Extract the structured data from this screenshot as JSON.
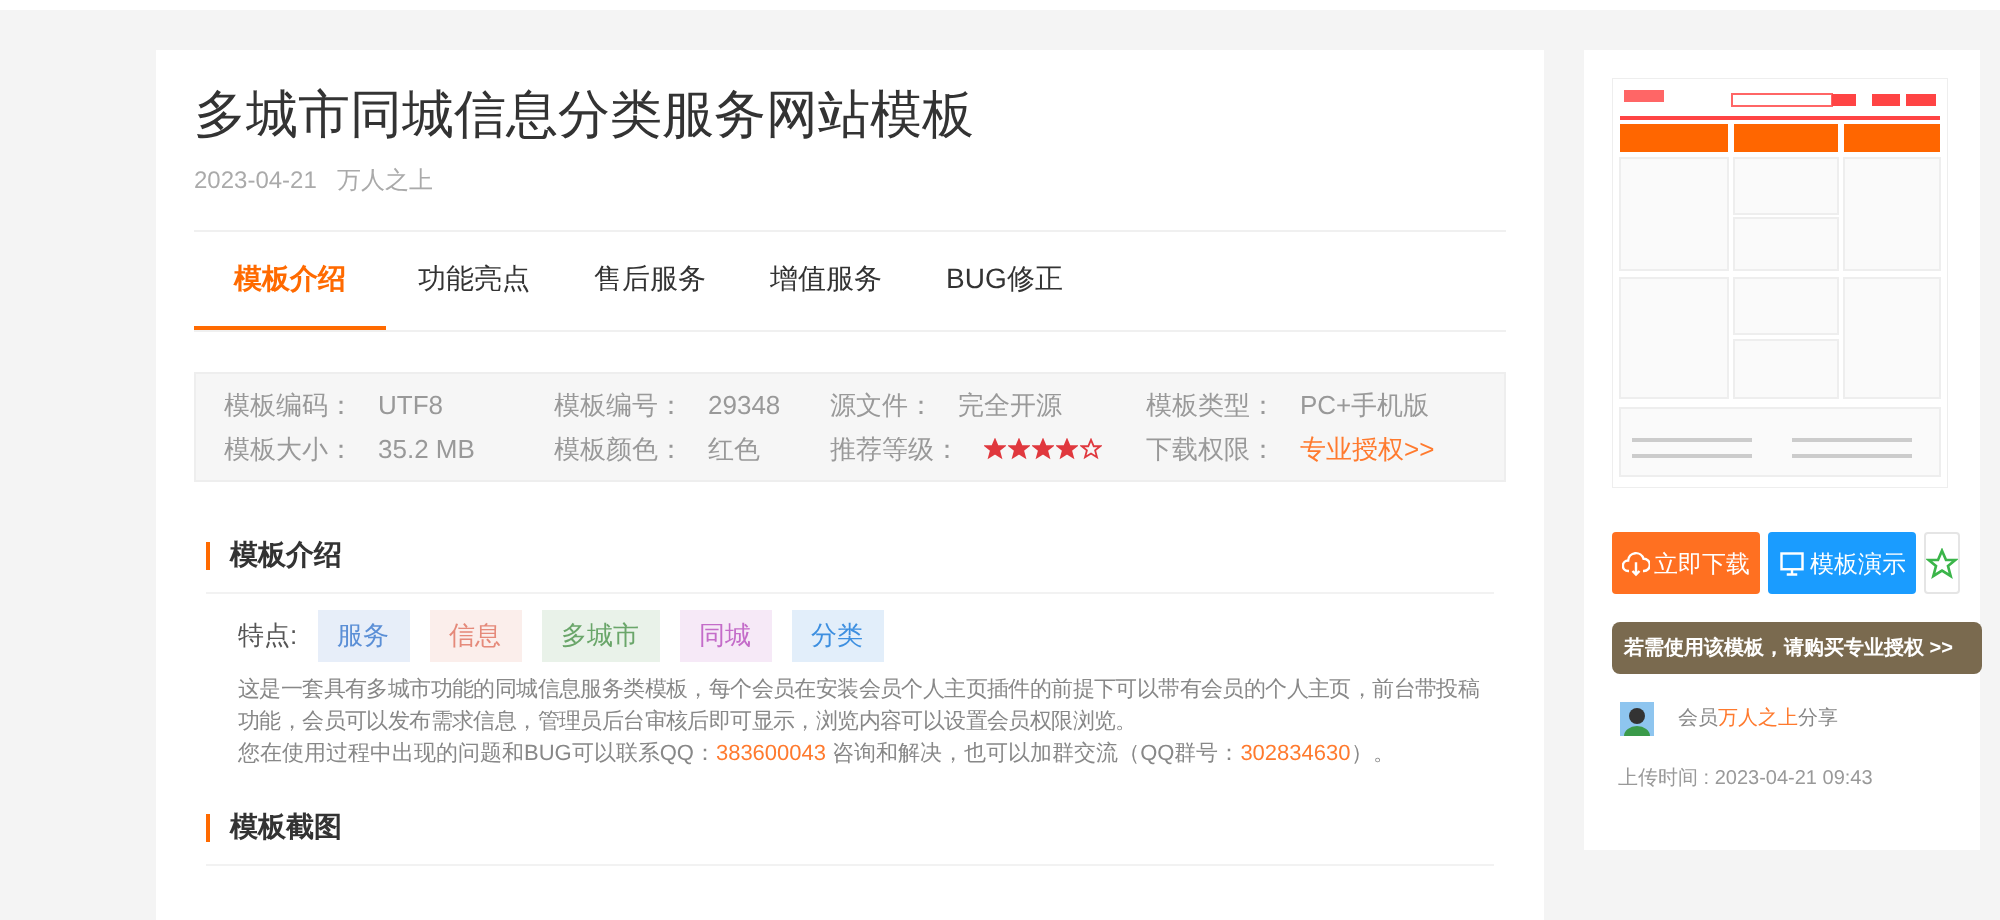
{
  "title": "多城市同城信息分类服务网站模板",
  "meta": {
    "date": "2023-04-21",
    "author": "万人之上"
  },
  "tabs": [
    {
      "label": "模板介绍",
      "selected": true
    },
    {
      "label": "功能亮点",
      "selected": false
    },
    {
      "label": "售后服务",
      "selected": false
    },
    {
      "label": "增值服务",
      "selected": false
    },
    {
      "label": "BUG修正",
      "selected": false
    }
  ],
  "specs": [
    {
      "label": "模板编码：",
      "value": "UTF8",
      "kind": "text"
    },
    {
      "label": "模板编号：",
      "value": "29348",
      "kind": "text"
    },
    {
      "label": "源文件：",
      "value": "完全开源",
      "kind": "text"
    },
    {
      "label": "模板类型：",
      "value": "PC+手机版",
      "kind": "text"
    },
    {
      "label": "模板大小：",
      "value": "35.2 MB",
      "kind": "text"
    },
    {
      "label": "模板颜色：",
      "value": "红色",
      "kind": "text"
    },
    {
      "label": "推荐等级：",
      "stars": 4,
      "kind": "stars"
    },
    {
      "label": "下载权限：",
      "value": "专业授权>>",
      "kind": "link"
    }
  ],
  "intro": {
    "heading": "模板介绍",
    "features_label": "特点:",
    "tags": [
      {
        "label": "服务",
        "color": "#5b8fd6"
      },
      {
        "label": "信息",
        "color": "#e58a7a"
      },
      {
        "label": "多城市",
        "color": "#6aa66a"
      },
      {
        "label": "同城",
        "color": "#c46cc9"
      },
      {
        "label": "分类",
        "color": "#3d8fe0"
      }
    ],
    "description": "这是一套具有多城市功能的同城信息服务类模板，每个会员在安装会员个人主页插件的前提下可以带有会员的个人主页，前台带投稿功能，会员可以发布需求信息，管理员后台审核后即可显示，浏览内容可以设置会员权限浏览。",
    "contact": [
      {
        "text": "您在使用过程中出现的问题和BUG可以联系QQ：",
        "kind": "plain"
      },
      {
        "text": "383600043",
        "kind": "highlight"
      },
      {
        "text": " 咨询和解决，也可以加群交流（QQ群号：",
        "kind": "plain"
      },
      {
        "text": "302834630",
        "kind": "highlight"
      },
      {
        "text": "）。",
        "kind": "plain"
      }
    ]
  },
  "screenshots": {
    "heading": "模板截图"
  },
  "sidebar": {
    "download_button": "立即下载",
    "demo_button": "模板演示",
    "license_banner": "若需使用该模板，请购买专业授权 >>",
    "share": {
      "prefix": "会员",
      "member": "万人之上",
      "suffix": "分享"
    },
    "upload_time": "上传时间 : 2023-04-21 09:43"
  }
}
